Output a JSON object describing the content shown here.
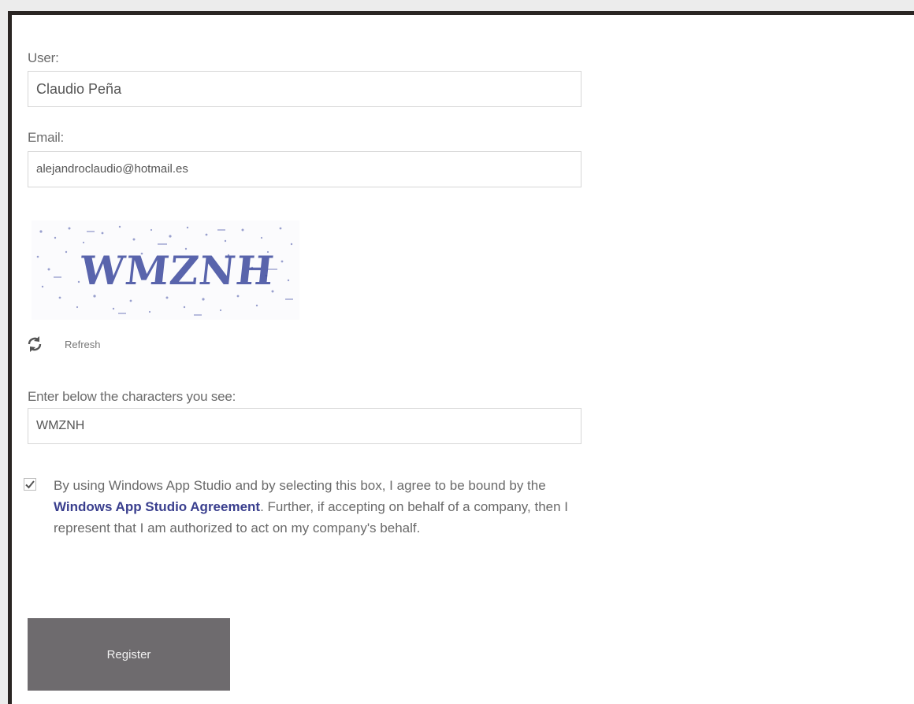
{
  "form": {
    "user_label": "User:",
    "user_value": "Claudio Peña",
    "email_label": "Email:",
    "email_value": "alejandroclaudio@hotmail.es",
    "captcha_text": "WMZNH",
    "refresh_label": "Refresh",
    "captcha_prompt": "Enter below the characters you see:",
    "captcha_value": "WMZNH",
    "agreement_before": "By using Windows App Studio and by selecting this box, I agree to be bound by the ",
    "agreement_link": "Windows App Studio Agreement",
    "agreement_after": ". Further, if accepting on behalf of a company, then I represent that I am authorized to act on my company's behalf.",
    "agreement_checked": true,
    "register_label": "Register"
  },
  "colors": {
    "frame": "#2a2523",
    "link": "#3a3f8e",
    "captcha_ink": "#3d4a9e",
    "register_bg": "#6e6b6e"
  },
  "icons": {
    "refresh": "refresh-icon",
    "checkbox": "checkbox-checked-icon"
  }
}
